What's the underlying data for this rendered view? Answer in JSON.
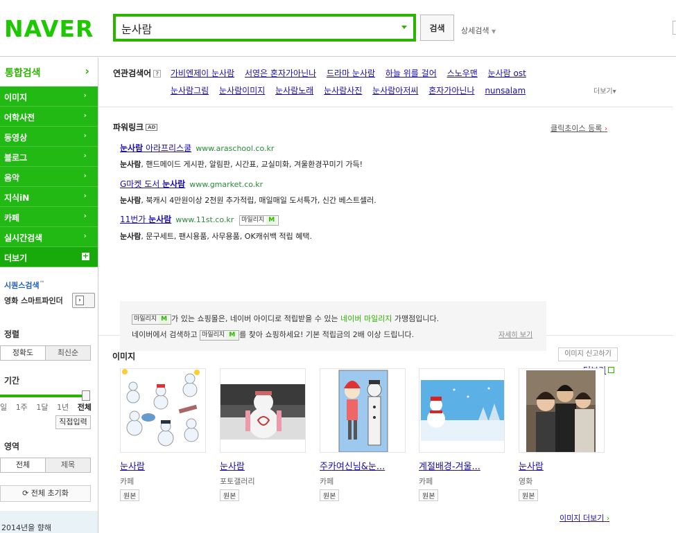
{
  "header": {
    "logo": "NAVER",
    "query": "눈사람",
    "search_button": "검색",
    "detail_search": "상세검색"
  },
  "lnb": {
    "current": "통합검색",
    "items": [
      {
        "label": "이미지"
      },
      {
        "label": "어학사전"
      },
      {
        "label": "동영상"
      },
      {
        "label": "블로그"
      },
      {
        "label": "음악"
      },
      {
        "label": "지식iN"
      },
      {
        "label": "카페"
      },
      {
        "label": "실시간검색"
      }
    ],
    "more": "더보기",
    "quick_title": "시퀀스검색",
    "quick_title_tm": "™",
    "quick_label": "영화 스마트파인더",
    "sort_label": "정렬",
    "sort_options": [
      "정확도",
      "최신순"
    ],
    "period_label": "기간",
    "period_options": [
      "일",
      "1주",
      "1달",
      "1년",
      "전체"
    ],
    "direct_input": "직접입력",
    "area_label": "영역",
    "area_options": [
      "전체",
      "제목"
    ],
    "reset": "⟳ 전체 초기화",
    "promo": "2014년을 향해"
  },
  "related": {
    "title": "연관검색어",
    "help": "?",
    "row1": [
      "가비엔제이 눈사람",
      "서영은 혼자가아닌나",
      "드라마 눈사람",
      "하늘 위를 걸어",
      "스노우맨",
      "눈사람 ost"
    ],
    "row2": [
      "눈사람그림",
      "눈사람이미지",
      "눈사람노래",
      "눈사람사진",
      "눈사람아저씨",
      "혼자가아닌나",
      "nunsalam"
    ],
    "more": "더보기▾"
  },
  "powerlink": {
    "title": "파워링크",
    "ad_badge": "AD",
    "register": "클릭초이스 등록",
    "ads": [
      {
        "kw": "눈사람",
        "rest": " 아라프리스쿨",
        "pre": "",
        "url": "www.araschool.co.kr",
        "desc_kw": "눈사람",
        "desc": ", 핸드메이드 게시판, 알림판, 시간표, 교실미화, 겨울환경꾸미기 가득!",
        "mileage": false
      },
      {
        "kw": "눈사람",
        "rest": "",
        "pre": "G마켓 도서 ",
        "url": "www.gmarket.co.kr",
        "desc_kw": "눈사람",
        "desc": ", 북캐시 4만원이상 2천원 추가적립, 매일매일 도서특가, 신간 베스트셀러.",
        "mileage": false
      },
      {
        "kw": "눈사람",
        "rest": "",
        "pre": "11번가 ",
        "url": "www.11st.co.kr",
        "desc_kw": "눈사람",
        "desc": ", 문구세트, 팬시용품, 사무용품, OK캐쉬백 적립 혜택.",
        "mileage": true
      }
    ],
    "mileage_label": "마일리지",
    "mileage_mark": "M",
    "notice_1a": "가 있는 쇼핑몰은, 네이버 아이디로 적립받을 수 있는 ",
    "notice_1b": "네이버 마일리지",
    "notice_1c": " 가맹점입니다.",
    "notice_2a": "네이버에서 검색하고 ",
    "notice_2b": "를 찾아 쇼핑하세요! 기본 적립금의 2배 이상 드립니다.",
    "notice_detail": "자세히 보기",
    "more": "더보기"
  },
  "images": {
    "title": "이미지",
    "report": "이미지 신고하기",
    "items": [
      {
        "title": "눈사람",
        "source": "카페",
        "orig": "원본"
      },
      {
        "title": "눈사람",
        "source": "포토갤러리",
        "orig": "원본"
      },
      {
        "title": "주카여신님&눈...",
        "source": "카페",
        "orig": "원본"
      },
      {
        "title": "계절배경-겨울...",
        "source": "카페",
        "orig": "원본"
      },
      {
        "title": "눈사람",
        "source": "영화",
        "orig": "원본"
      }
    ],
    "more": "이미지 더보기"
  },
  "colors": {
    "brand": "#2db400",
    "nav_bg": "#22b914",
    "link": "#1a0dab"
  }
}
